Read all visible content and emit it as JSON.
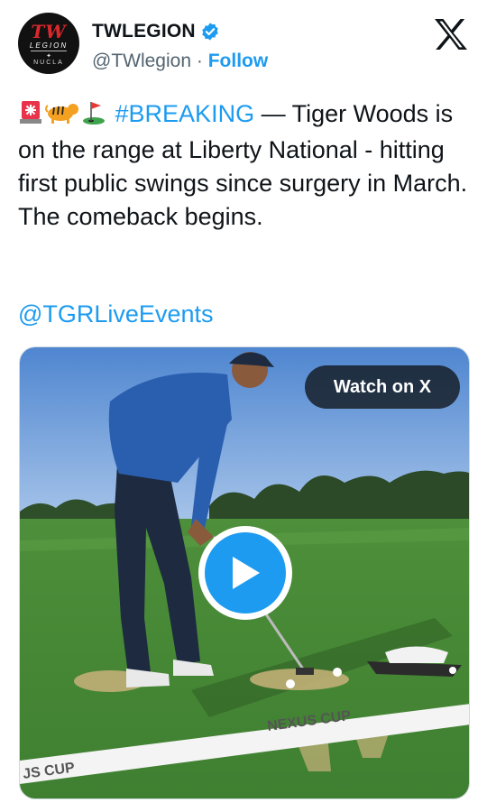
{
  "author": {
    "display_name": "TWLEGION",
    "handle": "@TWlegion",
    "separator": "·",
    "follow_label": "Follow",
    "verified": true,
    "avatar": {
      "text_main": "TW",
      "text_sub": "LEGION",
      "text_brand": "NUCLA",
      "icon": "tw-legion-logo"
    }
  },
  "platform_icon": "x-logo",
  "tweet": {
    "emojis": [
      "rotating-light",
      "tiger",
      "golf-flag"
    ],
    "hashtag": "#BREAKING",
    "body": " — Tiger Woods is on the range at Liberty National - hitting first public swings since surgery in March. The comeback begins.",
    "mention": "@TGRLiveEvents"
  },
  "media": {
    "watch_label": "Watch on X",
    "play_icon": "play-icon",
    "banner_text_right": "NEXUS CUP",
    "banner_text_left": "JS CUP"
  },
  "colors": {
    "accent": "#1d9bf0",
    "text": "#0f1419",
    "secondary": "#536471",
    "verified": "#1d9bf0"
  }
}
